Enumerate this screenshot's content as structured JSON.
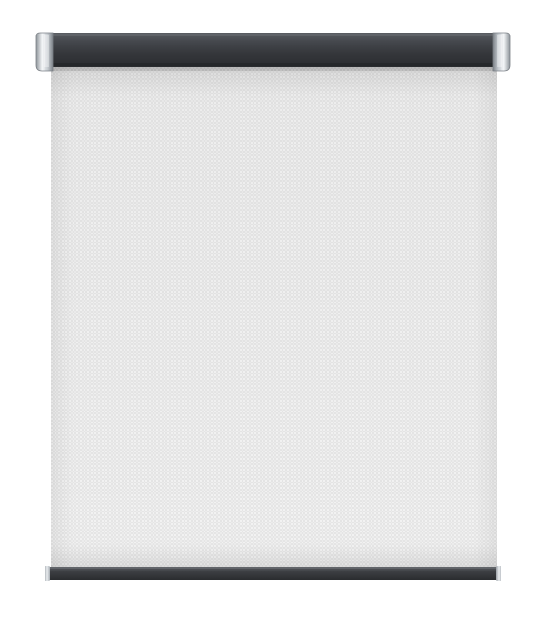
{
  "product": {
    "type": "roller-blind",
    "colors": {
      "fabric": "#e6e6e6",
      "fabric_shadow": "#d4d4d4",
      "fabric_dots": "#f7f7f7",
      "cassette": "#3a3c40",
      "cassette_highlight": "#56595e",
      "end_cap_light": "#eceff2",
      "end_cap_dark": "#9aa0a6",
      "bottom_rail": "#3b3d41",
      "background": "#ffffff"
    },
    "icons": {
      "left_end_cap": "left-end-cap-icon",
      "right_end_cap": "right-end-cap-icon"
    }
  }
}
